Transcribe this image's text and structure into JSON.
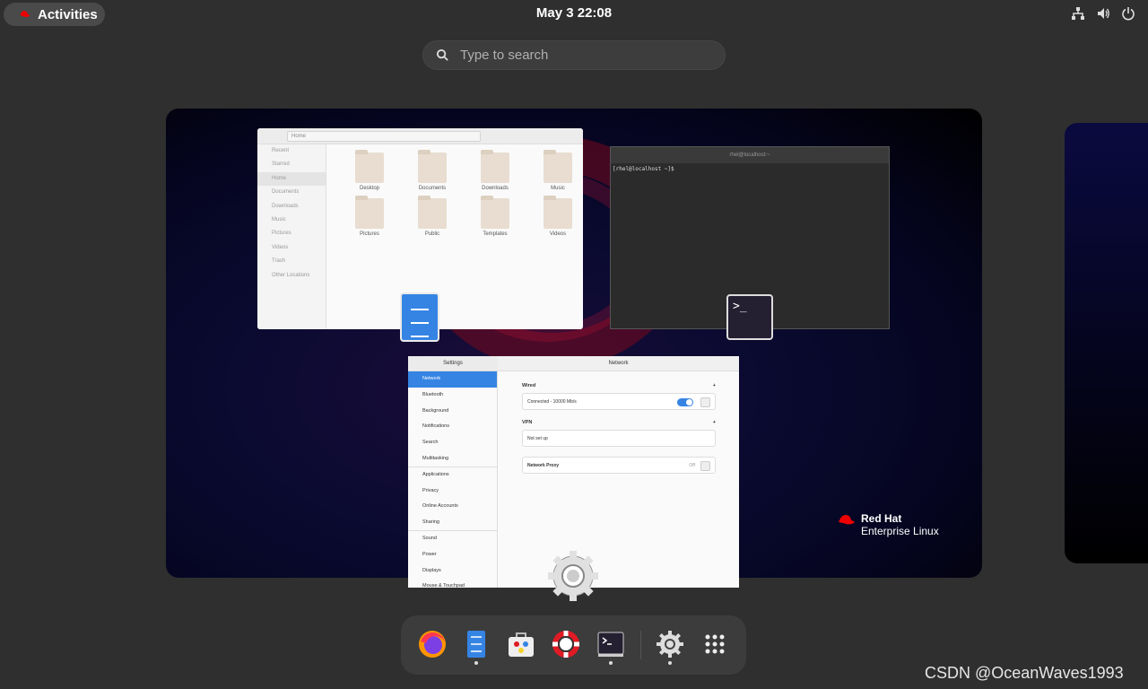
{
  "topbar": {
    "activities_label": "Activities",
    "clock": "May 3  22:08"
  },
  "search": {
    "placeholder": "Type to search"
  },
  "files_window": {
    "path": "Home",
    "sidebar": [
      "Recent",
      "Starred",
      "Home",
      "Documents",
      "Downloads",
      "Music",
      "Pictures",
      "Videos",
      "Trash",
      "Other Locations"
    ],
    "folders": [
      "Desktop",
      "Documents",
      "Downloads",
      "Music",
      "Pictures",
      "Public",
      "Templates",
      "Videos"
    ]
  },
  "terminal_window": {
    "title": "rhel@localhost:~",
    "prompt": "[rhel@localhost ~]$ "
  },
  "settings_window": {
    "left_title": "Settings",
    "right_title": "Network",
    "sidebar": [
      "Network",
      "Bluetooth",
      "Background",
      "Notifications",
      "Search",
      "Multitasking",
      "Applications",
      "Privacy",
      "Online Accounts",
      "Sharing",
      "Sound",
      "Power",
      "Displays",
      "Mouse & Touchpad"
    ],
    "wired_label": "Wired",
    "wired_status": "Connected - 10000 Mb/s",
    "vpn_label": "VPN",
    "vpn_status": "Not set up",
    "proxy_label": "Network Proxy",
    "proxy_state": "Off",
    "add_symbol": "+"
  },
  "wallpaper": {
    "brand_line1": "Red Hat",
    "brand_line2": "Enterprise Linux"
  },
  "dash": {
    "apps": [
      "firefox-icon",
      "files-icon",
      "software-icon",
      "help-icon",
      "terminal-icon",
      "settings-icon",
      "app-grid-icon"
    ]
  },
  "watermark": "CSDN @OceanWaves1993",
  "colors": {
    "accent": "#3584e4",
    "panel": "#2f2f2f",
    "redhat": "#ee0000"
  }
}
